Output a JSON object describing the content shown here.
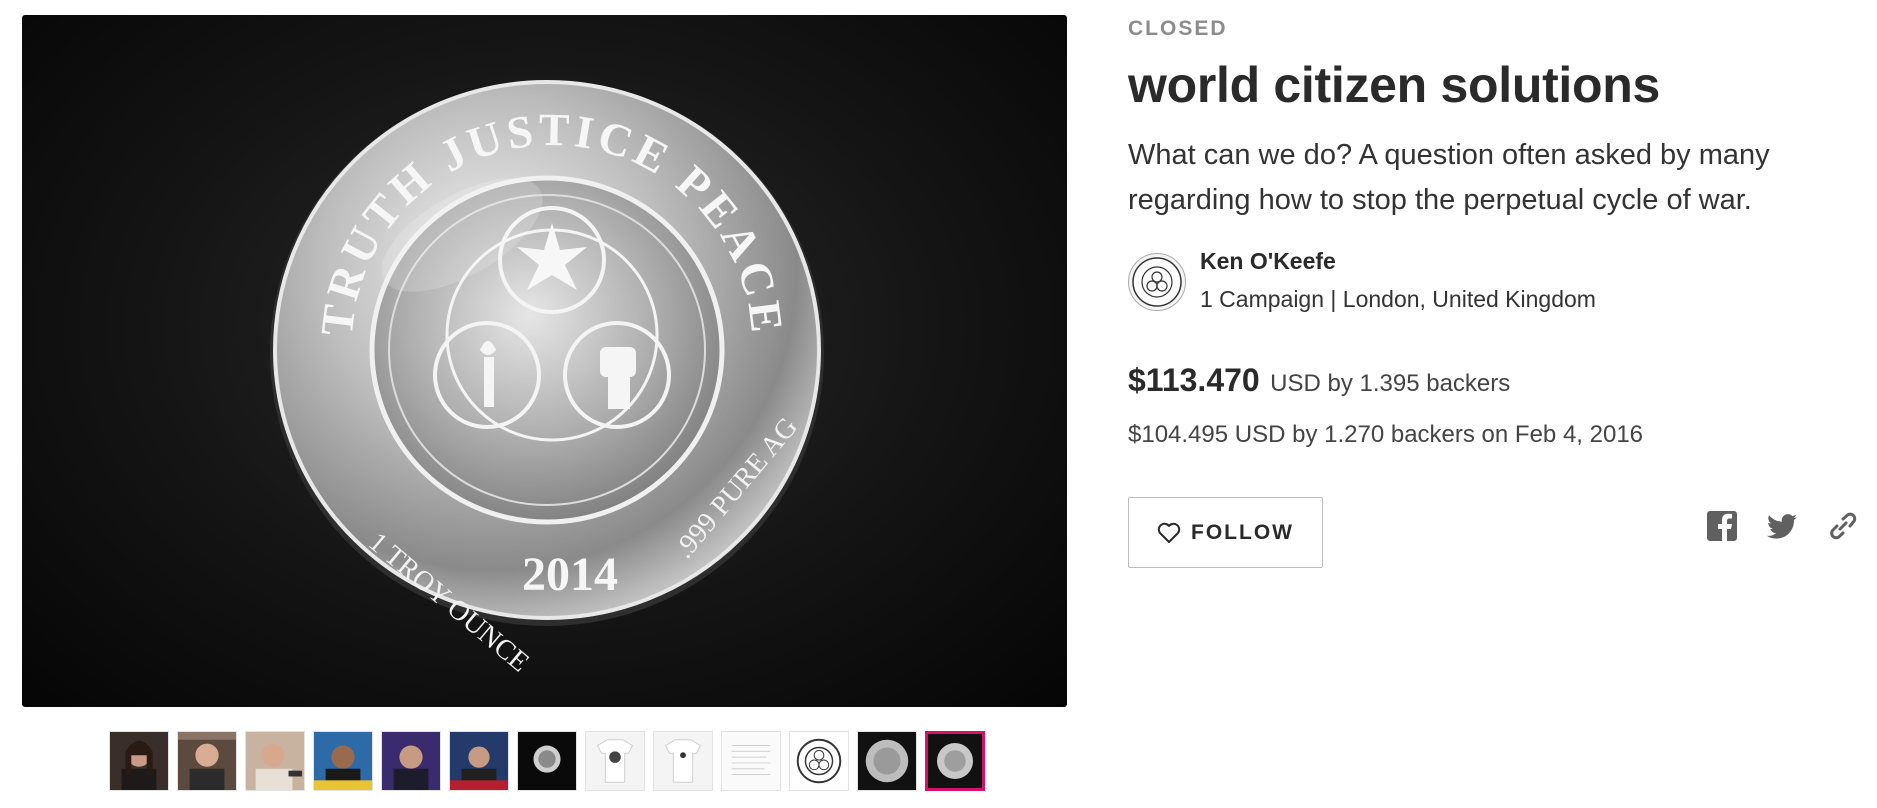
{
  "campaign": {
    "status": "CLOSED",
    "title": "world citizen solutions",
    "tagline": "What can we do? A question often asked by many regarding how to stop the perpetual cycle of war."
  },
  "owner": {
    "name": "Ken O'Keefe",
    "meta": "1 Campaign | London, United Kingdom",
    "avatar_icon": "coin-logo-avatar"
  },
  "funding": {
    "amount": "$113.470",
    "amount_suffix": "USD by 1.395 backers",
    "snapshot": "$104.495 USD by 1.270 backers on Feb 4, 2016"
  },
  "actions": {
    "follow_label": "FOLLOW",
    "follow_icon": "heart-outline-icon",
    "share": [
      {
        "icon": "facebook-icon"
      },
      {
        "icon": "twitter-icon"
      },
      {
        "icon": "link-icon"
      }
    ]
  },
  "media": {
    "coin_text": {
      "top": "TRUTH JUSTICE PEACE",
      "bottom_left": "1 TROY OUNCE",
      "year": "2014",
      "bottom_right": ".999 PURE AG"
    },
    "thumbnails_count": 13,
    "active_thumbnail_index": 12
  },
  "colors": {
    "accent_active": "#d6116a",
    "text_primary": "#2a2a2a",
    "status_gray": "#8c8c8c"
  }
}
